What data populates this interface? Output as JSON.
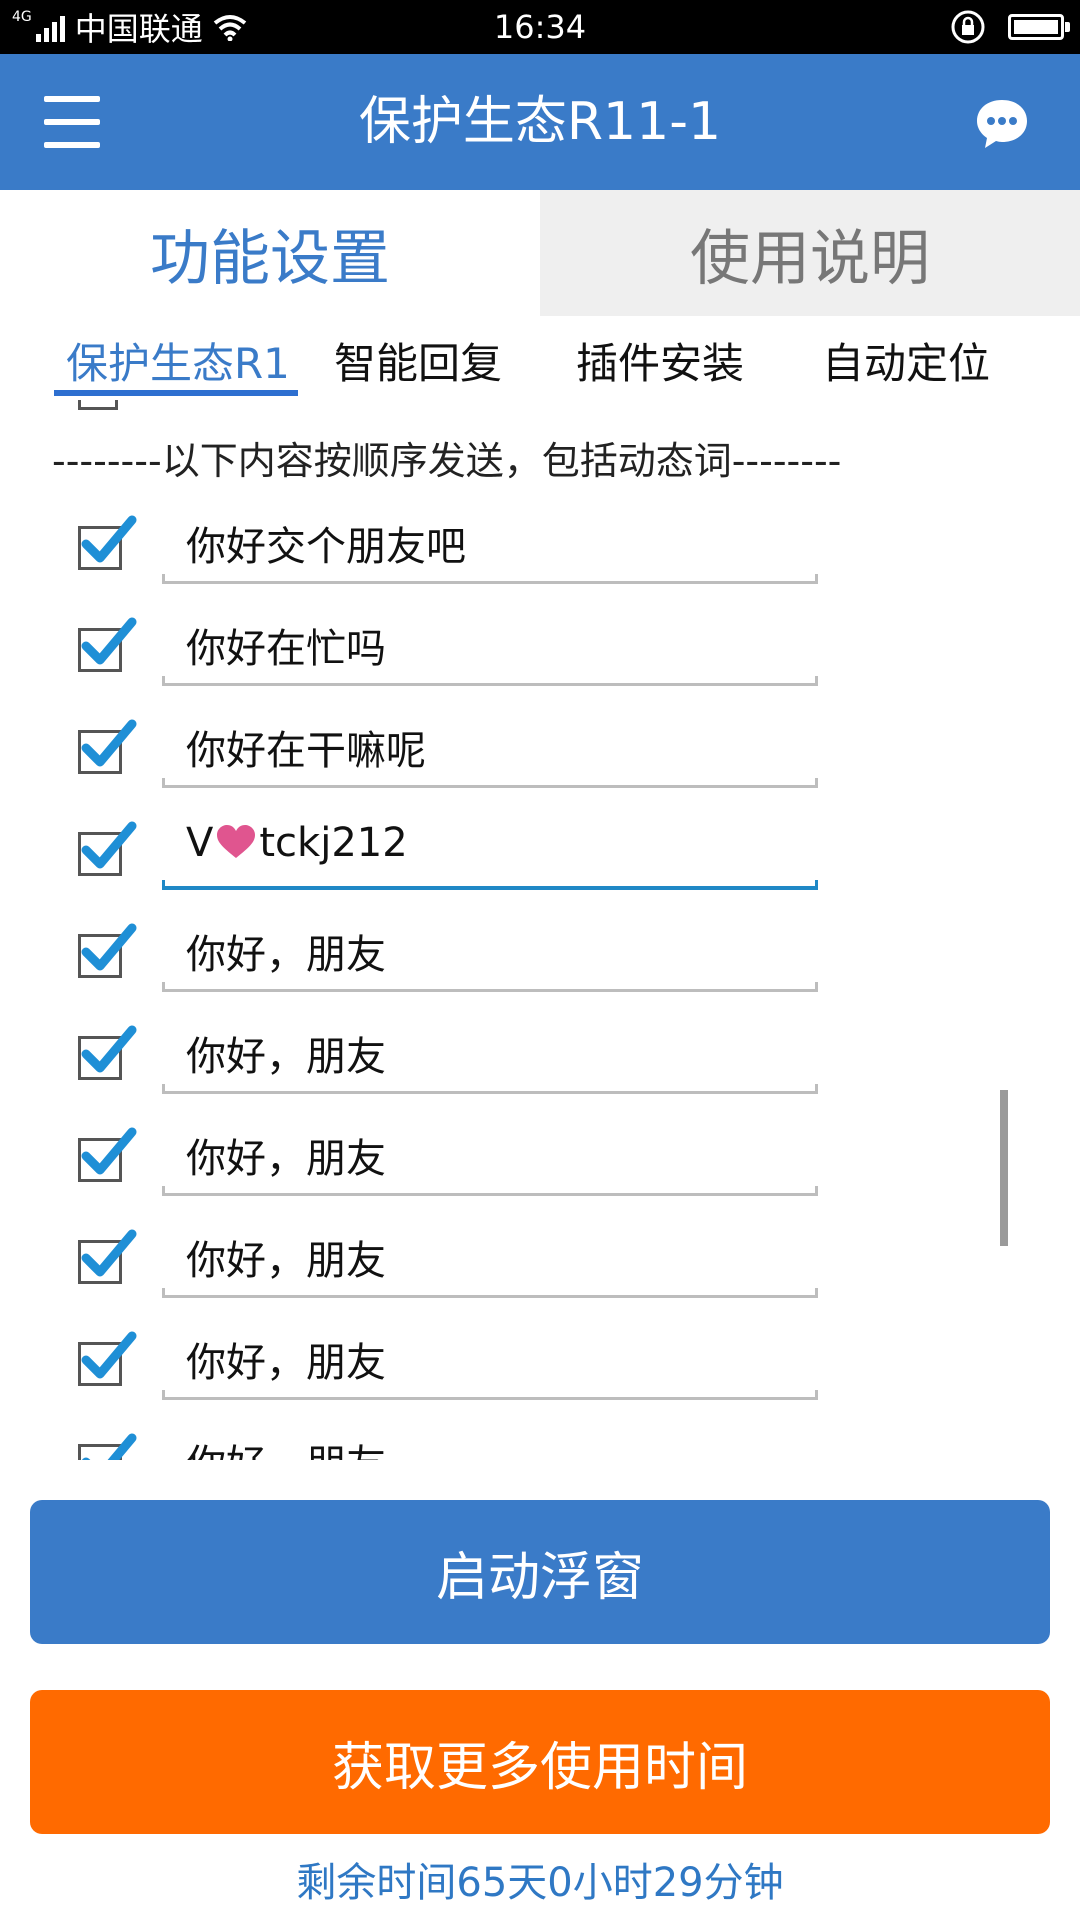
{
  "status_bar": {
    "network": "4G",
    "carrier": "中国联通",
    "time": "16:34",
    "battery_level": 1.0
  },
  "app_bar": {
    "title": "保护生态R11-1"
  },
  "main_tabs": [
    {
      "label": "功能设置",
      "active": true
    },
    {
      "label": "使用说明",
      "active": false
    }
  ],
  "sub_tabs": [
    {
      "label": "保护生态R1",
      "active": true
    },
    {
      "label": "智能回复",
      "active": false
    },
    {
      "label": "插件安装",
      "active": false
    },
    {
      "label": "自动定位",
      "active": false
    }
  ],
  "list": {
    "section_title": "--------以下内容按顺序发送，包括动态词--------",
    "items": [
      {
        "text": "你好交个朋友吧",
        "checked": true
      },
      {
        "text": "你好在忙吗",
        "checked": true
      },
      {
        "text": "你好在干嘛呢",
        "checked": true
      },
      {
        "text_prefix": "V",
        "text_suffix": "tckj212",
        "checked": true,
        "focused": true
      },
      {
        "text": "你好，朋友",
        "checked": true
      },
      {
        "text": "你好，朋友",
        "checked": true
      },
      {
        "text": "你好，朋友",
        "checked": true
      },
      {
        "text": "你好，朋友",
        "checked": true
      },
      {
        "text": "你好，朋友",
        "checked": true
      },
      {
        "text": "你好，朋友",
        "checked": true
      }
    ]
  },
  "buttons": {
    "start_float": "启动浮窗",
    "get_more_time": "获取更多使用时间"
  },
  "remaining_time": "剩余时间65天0小时29分钟",
  "colors": {
    "primary": "#3a7bc8",
    "accent_orange": "#ff6a00",
    "check_blue": "#1f8fd6",
    "heart_pink": "#e0558f"
  }
}
